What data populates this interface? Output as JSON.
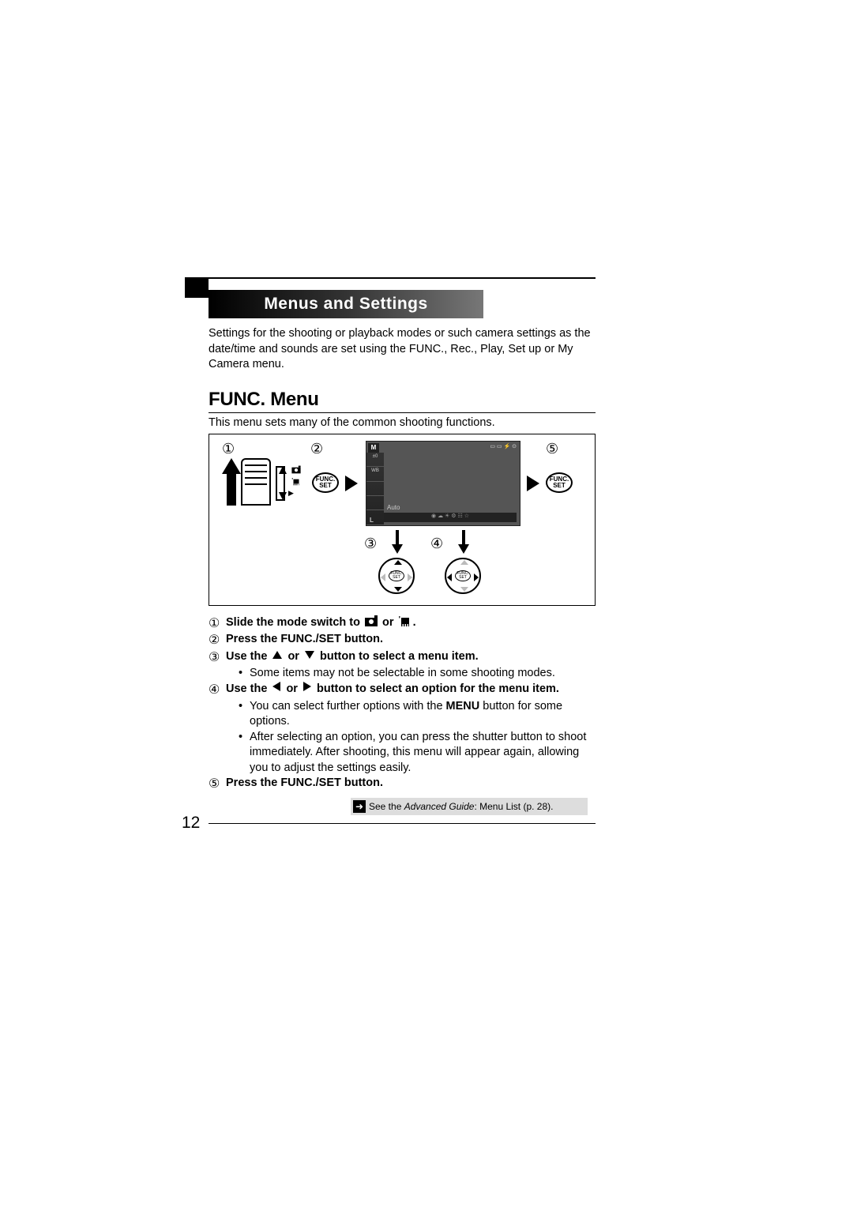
{
  "title_bar": "Menus and Settings",
  "intro": "Settings for the shooting or playback modes or such camera settings as the date/time and sounds are set using the FUNC., Rec., Play, Set up or My Camera menu.",
  "heading": "FUNC. Menu",
  "subheading": "This menu sets many of the common shooting functions.",
  "diagram": {
    "labels": [
      "①",
      "②",
      "③",
      "④",
      "⑤"
    ],
    "func_label_top": "FUNC.",
    "func_label_bot": "SET",
    "screen": {
      "mode_badge": "M",
      "side_items": [
        "±0",
        "WB",
        "",
        "",
        ""
      ],
      "auto_label": "Auto",
      "top_icons": "▭ ▭  ⚡ ⊙",
      "bottom_row": "◉ ☁ ☀ ⚙ ☷ ☆",
      "corner": "L"
    },
    "switch_icons": [
      "camera",
      "movie",
      "play"
    ]
  },
  "steps": {
    "s1_prefix": "Slide the mode switch to ",
    "s1_or": " or ",
    "s1_suffix": ".",
    "s2": "Press the FUNC./SET button.",
    "s3_prefix": "Use the ",
    "s3_or": " or ",
    "s3_suffix": " button to select a menu item.",
    "s3_bullet": "Some items may not be selectable in some shooting modes.",
    "s4_prefix": "Use the ",
    "s4_or": " or ",
    "s4_suffix": " button to select an option for the menu item.",
    "s4_bullet1_a": "You can select further options with the ",
    "s4_bullet1_menu": "MENU",
    "s4_bullet1_b": " button for some options.",
    "s4_bullet2": "After selecting an option, you can press the shutter button to shoot immediately. After shooting, this menu will appear again, allowing you to adjust the settings easily.",
    "s5": "Press the FUNC./SET button.",
    "nums": [
      "①",
      "②",
      "③",
      "④",
      "⑤"
    ]
  },
  "see_ref": {
    "prefix": "See the ",
    "doc": "Advanced Guide",
    "suffix": ": Menu List (p. 28)."
  },
  "page_number": "12"
}
